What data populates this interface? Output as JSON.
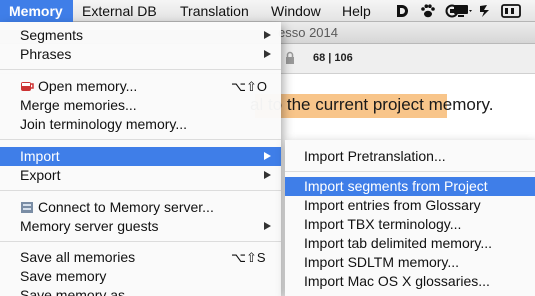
{
  "menubar": {
    "items": [
      {
        "label": "Memory",
        "active": true
      },
      {
        "label": "External DB"
      },
      {
        "label": "Translation"
      },
      {
        "label": "Window"
      },
      {
        "label": "Help"
      }
    ],
    "status_icons": [
      "d-app-icon",
      "paw-icon",
      "spotlight-icon",
      "display-icon",
      "sync-icon",
      "flashlight-icon"
    ]
  },
  "background_window": {
    "title_fragment": "esso 2014",
    "counter": "68 | 106",
    "body_text": "al to the current project memory."
  },
  "memory_menu": {
    "items": [
      {
        "label": "Segments",
        "submenu": true
      },
      {
        "label": "Phrases",
        "submenu": true
      },
      {
        "label": "Open memory...",
        "shortcut": "⌥⇧O",
        "icon": "coffee-cup-icon"
      },
      {
        "label": "Merge memories..."
      },
      {
        "label": "Join terminology memory..."
      },
      {
        "label": "Import",
        "submenu": true,
        "highlighted": true
      },
      {
        "label": "Export",
        "submenu": true
      },
      {
        "label": "Connect to Memory server...",
        "icon": "server-icon"
      },
      {
        "label": "Memory server guests",
        "submenu": true
      },
      {
        "label": "Save all memories",
        "shortcut": "⌥⇧S"
      },
      {
        "label": "Save memory"
      },
      {
        "label": "Save memory as..."
      }
    ]
  },
  "import_submenu": {
    "items": [
      {
        "label": "Import Pretranslation..."
      },
      {
        "label": "Import segments from Project",
        "highlighted": true
      },
      {
        "label": "Import entries from Glossary"
      },
      {
        "label": "Import TBX terminology..."
      },
      {
        "label": "Import tab delimited memory..."
      },
      {
        "label": "Import SDLTM memory..."
      },
      {
        "label": "Import Mac OS X glossaries..."
      }
    ]
  },
  "colors": {
    "highlight": "#3f7ee8",
    "text_highlight": "#f8c58a"
  }
}
